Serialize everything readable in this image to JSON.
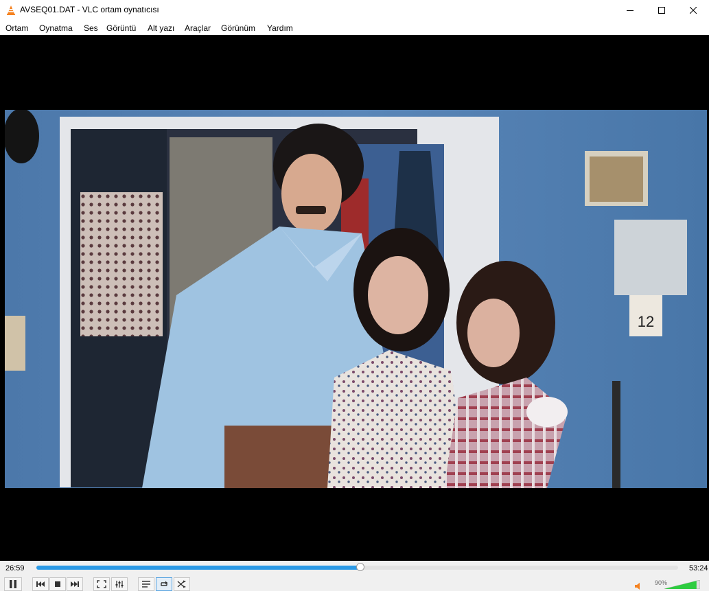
{
  "window": {
    "title": "AVSEQ01.DAT - VLC ortam oynatıcısı",
    "icon": "vlc-cone-icon",
    "minimize_icon": "minimize-icon",
    "maximize_icon": "maximize-icon",
    "close_icon": "close-icon"
  },
  "menu": {
    "items": [
      "Ortam",
      "Oynatma",
      "Ses",
      "Görüntü",
      "Alt yazı",
      "Araçlar",
      "Görünüm",
      "Yardım"
    ]
  },
  "video": {
    "calendar_day": "12"
  },
  "playback": {
    "elapsed": "26:59",
    "total": "53:24",
    "progress": 0.505,
    "state": "playing"
  },
  "controls": {
    "buttons": [
      {
        "name": "pause-icon",
        "active": false
      },
      {
        "name": "previous-icon",
        "active": false
      },
      {
        "name": "stop-icon",
        "active": false
      },
      {
        "name": "next-icon",
        "active": false
      },
      {
        "name": "fullscreen-icon",
        "active": false
      },
      {
        "name": "extended-settings-icon",
        "active": false
      },
      {
        "name": "playlist-icon",
        "active": false
      },
      {
        "name": "loop-icon",
        "active": true
      },
      {
        "name": "shuffle-icon",
        "active": false
      }
    ]
  },
  "volume": {
    "label": "90%",
    "level": 0.9,
    "icon": "speaker-icon"
  },
  "colors": {
    "accent": "#2c9ae6",
    "volume_fill": "#2ecc40",
    "vlc_orange": "#f58220"
  }
}
